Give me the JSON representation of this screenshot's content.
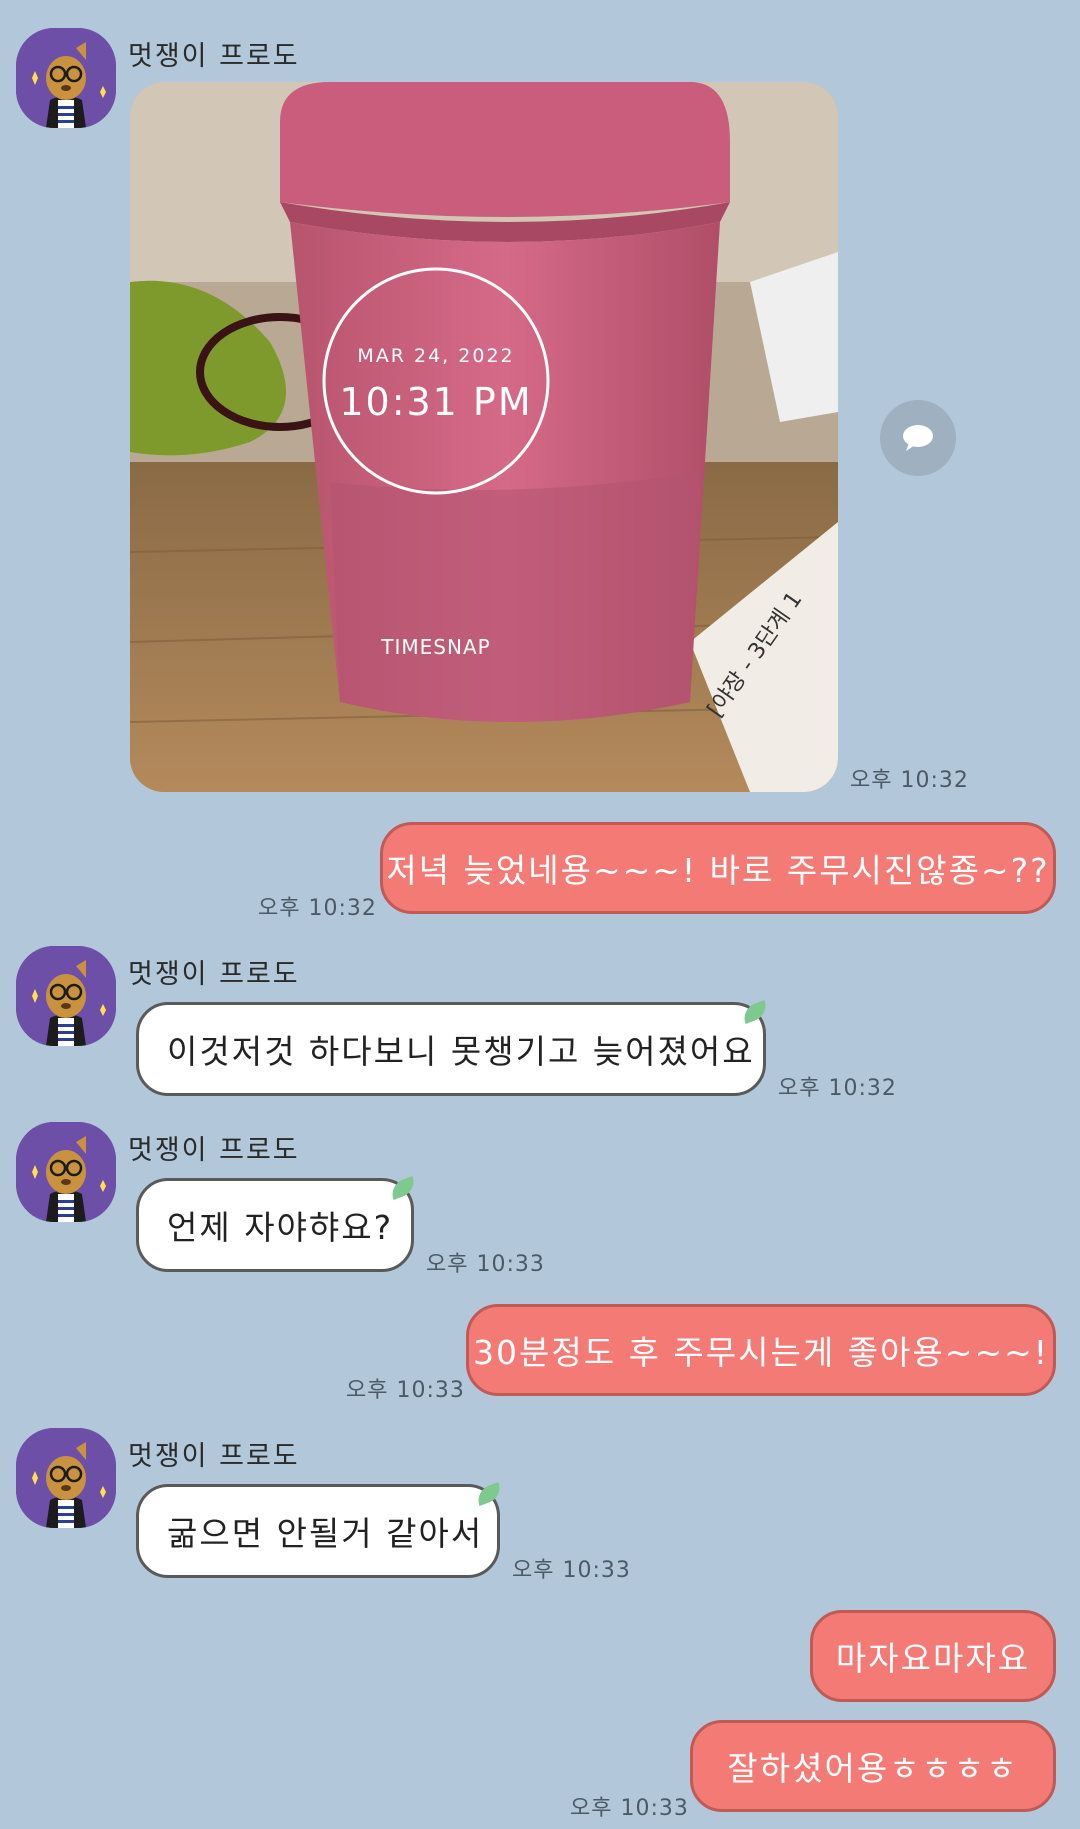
{
  "sender_name": "멋쟁이 프로도",
  "photo": {
    "date": "MAR 24, 2022",
    "time": "10:31 PM",
    "brand": "TIMESNAP",
    "sticker": "[야장 - 3단계 1"
  },
  "messages": [
    {
      "text": "저녁 늦었네용~~~! 바로 주무시진않죵~??",
      "time": "오후 10:32"
    },
    {
      "text": "이것저것 하다보니 못챙기고 늦어졌어요",
      "time": "오후 10:32"
    },
    {
      "text": "언제 자야햐요?",
      "time": "오후 10:33"
    },
    {
      "text": "30분정도 후 주무시는게 좋아용~~~!",
      "time": "오후 10:33"
    },
    {
      "text": "굶으면 안될거 같아서",
      "time": "오후 10:33"
    },
    {
      "text": "마자요마자요",
      "time": ""
    },
    {
      "text": "잘하셨어용ㅎㅎㅎㅎ",
      "time": "오후 10:33"
    }
  ],
  "photo_time": "오후 10:32",
  "icons": {
    "avatar": "frodo-avatar-icon",
    "share": "speech-bubble-icon",
    "leaf": "leaf-icon"
  },
  "colors": {
    "background": "#b2c7d9",
    "outgoing_bubble": "#f47a76",
    "incoming_bubble": "#ffffff"
  }
}
